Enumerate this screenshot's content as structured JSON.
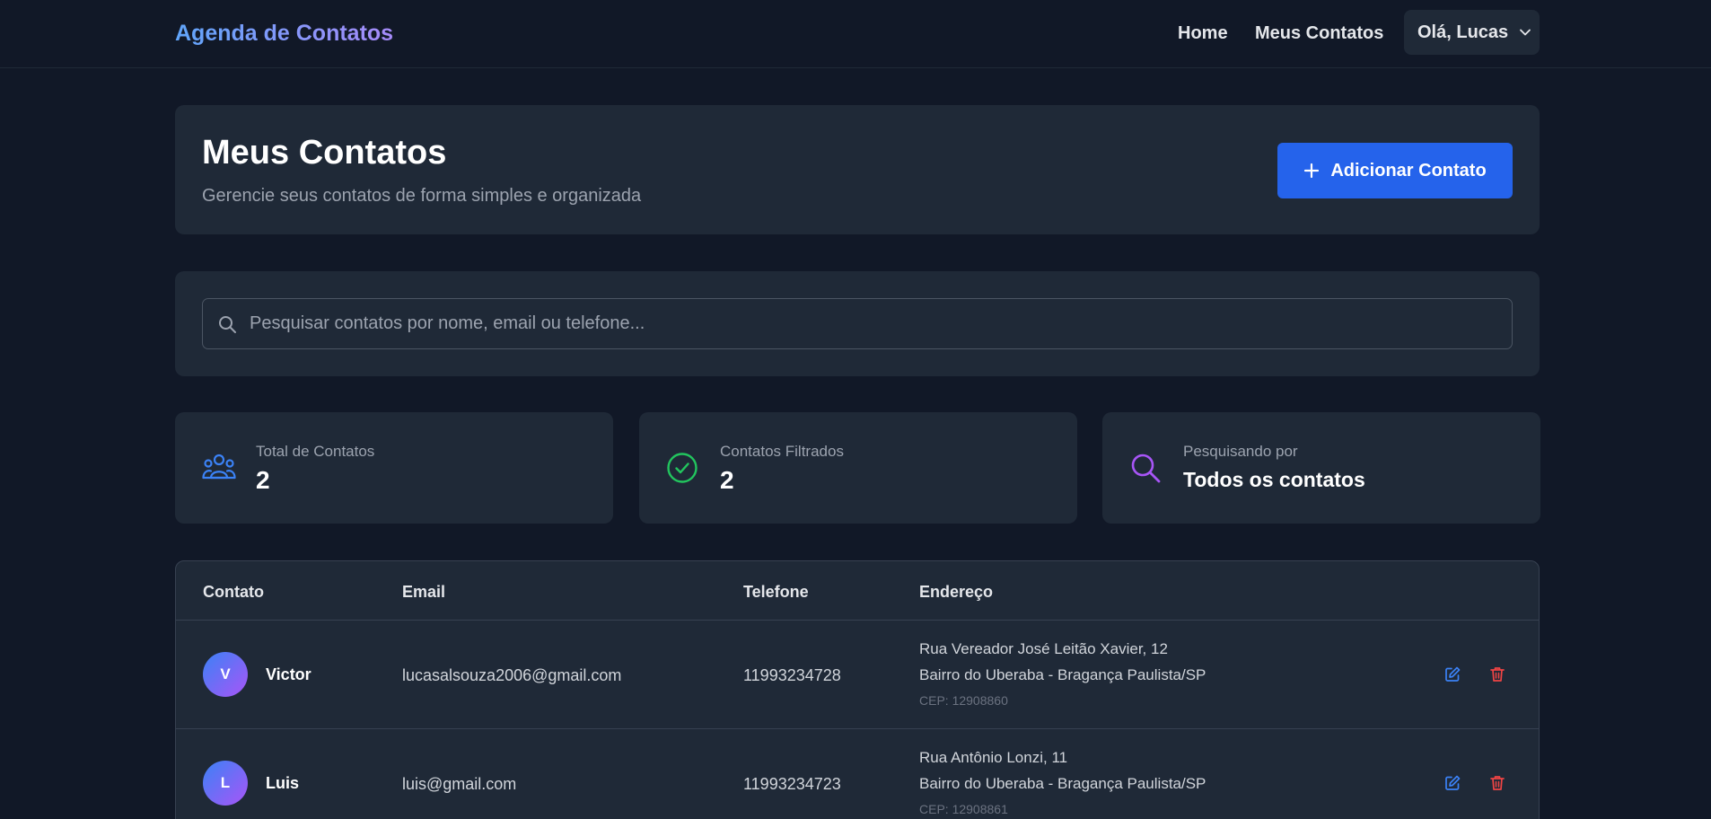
{
  "navbar": {
    "brand": "Agenda de Contatos",
    "links": [
      "Home",
      "Meus Contatos"
    ],
    "user_greeting": "Olá, Lucas"
  },
  "header": {
    "title": "Meus Contatos",
    "subtitle": "Gerencie seus contatos de forma simples e organizada",
    "add_button_label": "Adicionar Contato"
  },
  "search": {
    "placeholder": "Pesquisar contatos por nome, email ou telefone...",
    "value": ""
  },
  "stats": [
    {
      "label": "Total de Contatos",
      "value": "2",
      "icon": "users-icon",
      "color": "#3b82f6"
    },
    {
      "label": "Contatos Filtrados",
      "value": "2",
      "icon": "check-circle-icon",
      "color": "#22c55e"
    },
    {
      "label": "Pesquisando por",
      "value": "Todos os contatos",
      "icon": "search-icon",
      "color": "#a855f7"
    }
  ],
  "table": {
    "headers": [
      "Contato",
      "Email",
      "Telefone",
      "Endereço"
    ],
    "rows": [
      {
        "initial": "V",
        "name": "Victor",
        "email": "lucasalsouza2006@gmail.com",
        "phone": "11993234728",
        "address_line1": "Rua Vereador José Leitão Xavier, 12",
        "address_line2": "Bairro do Uberaba - Bragança Paulista/SP",
        "cep": "CEP: 12908860"
      },
      {
        "initial": "L",
        "name": "Luis",
        "email": "luis@gmail.com",
        "phone": "11993234723",
        "address_line1": "Rua Antônio Lonzi, 11",
        "address_line2": "Bairro do Uberaba - Bragança Paulista/SP",
        "cep": "CEP: 12908861"
      }
    ]
  },
  "colors": {
    "background": "#111827",
    "card": "#1f2937",
    "primary": "#2563eb",
    "edit": "#3b82f6",
    "delete": "#ef4444"
  }
}
